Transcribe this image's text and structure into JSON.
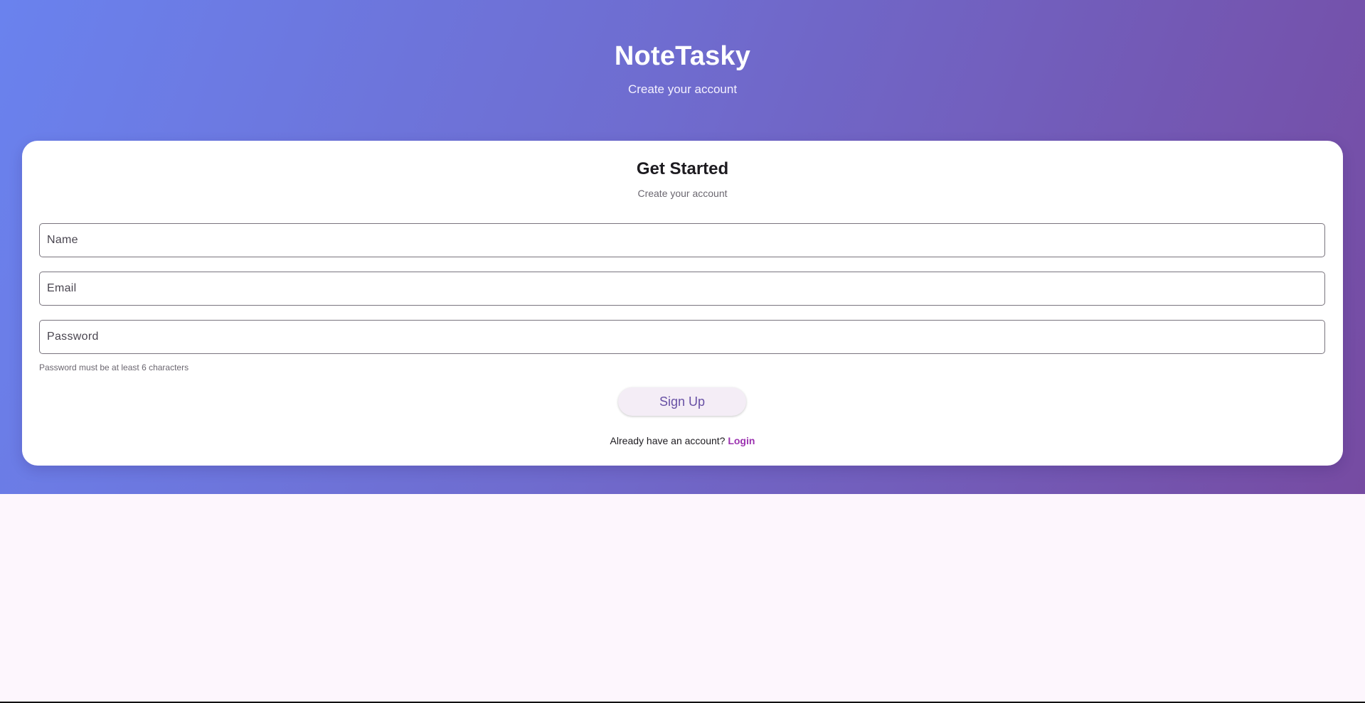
{
  "header": {
    "app_title": "NoteTasky",
    "subtitle": "Create your account"
  },
  "form": {
    "title": "Get Started",
    "subtitle": "Create your account",
    "name_placeholder": "Name",
    "email_placeholder": "Email",
    "password_placeholder": "Password",
    "password_helper": "Password must be at least 6 characters",
    "submit_label": "Sign Up",
    "footer_prompt": "Already have an account?",
    "login_label": "Login"
  },
  "colors": {
    "gradient_start": "#6a82ee",
    "gradient_end": "#764ba2",
    "accent": "#6750a4",
    "link": "#9c33b0",
    "page_background": "#fdf6fd"
  }
}
